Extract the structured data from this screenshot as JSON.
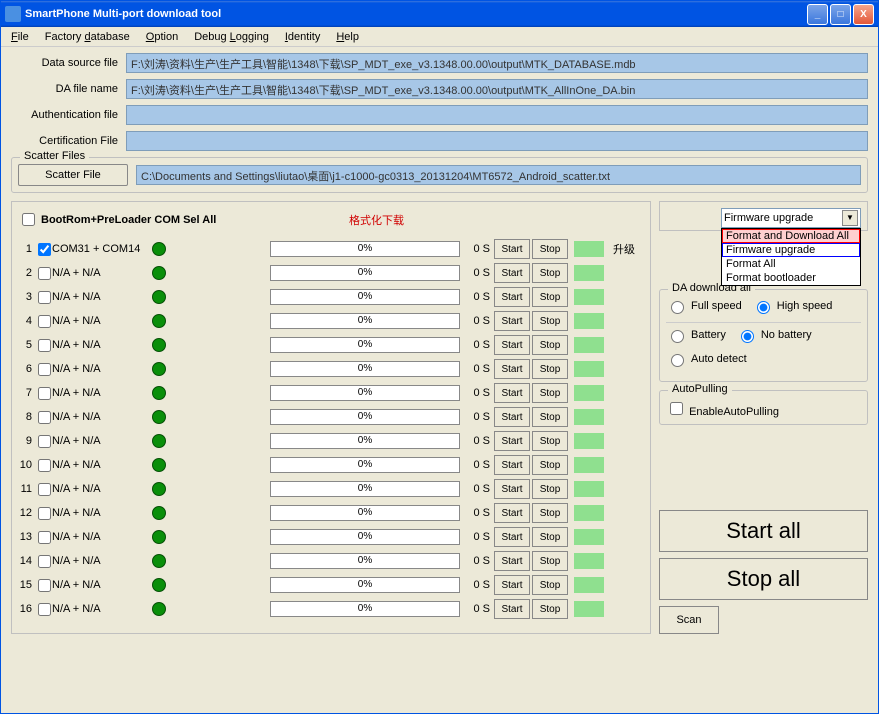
{
  "window": {
    "title": "SmartPhone Multi-port download tool"
  },
  "menu": {
    "file": "File",
    "factory": "Factory database",
    "option": "Option",
    "debug": "Debug Logging",
    "identity": "Identity",
    "help": "Help"
  },
  "files": {
    "datasource_label": "Data source file",
    "datasource_value": "F:\\刘涛\\资料\\生产\\生产工具\\智能\\1348\\下载\\SP_MDT_exe_v3.1348.00.00\\output\\MTK_DATABASE.mdb",
    "da_label": "DA file name",
    "da_value": "F:\\刘涛\\资料\\生产\\生产工具\\智能\\1348\\下载\\SP_MDT_exe_v3.1348.00.00\\output\\MTK_AllInOne_DA.bin",
    "auth_label": "Authentication file",
    "auth_value": "",
    "cert_label": "Certification File",
    "cert_value": ""
  },
  "scatter": {
    "legend": "Scatter Files",
    "button": "Scatter File",
    "path": "C:\\Documents and Settings\\liutao\\桌面\\j1-c1000-gc0313_20131204\\MT6572_Android_scatter.txt"
  },
  "bootrom_label": "BootRom+PreLoader COM Sel All",
  "format_label": "格式化下载",
  "upgrade_label": "升级",
  "dropdown": {
    "selected": "Firmware upgrade",
    "options": [
      "Format and Download All",
      "Firmware upgrade",
      "Format All",
      "Format bootloader"
    ]
  },
  "ports": [
    {
      "num": "1",
      "name": "COM31 + COM14",
      "checked": true,
      "progress": "0%",
      "time": "0 S",
      "start": "Start",
      "stop": "Stop"
    },
    {
      "num": "2",
      "name": "N/A + N/A",
      "checked": false,
      "progress": "0%",
      "time": "0 S",
      "start": "Start",
      "stop": "Stop"
    },
    {
      "num": "3",
      "name": "N/A + N/A",
      "checked": false,
      "progress": "0%",
      "time": "0 S",
      "start": "Start",
      "stop": "Stop"
    },
    {
      "num": "4",
      "name": "N/A + N/A",
      "checked": false,
      "progress": "0%",
      "time": "0 S",
      "start": "Start",
      "stop": "Stop"
    },
    {
      "num": "5",
      "name": "N/A + N/A",
      "checked": false,
      "progress": "0%",
      "time": "0 S",
      "start": "Start",
      "stop": "Stop"
    },
    {
      "num": "6",
      "name": "N/A + N/A",
      "checked": false,
      "progress": "0%",
      "time": "0 S",
      "start": "Start",
      "stop": "Stop"
    },
    {
      "num": "7",
      "name": "N/A + N/A",
      "checked": false,
      "progress": "0%",
      "time": "0 S",
      "start": "Start",
      "stop": "Stop"
    },
    {
      "num": "8",
      "name": "N/A + N/A",
      "checked": false,
      "progress": "0%",
      "time": "0 S",
      "start": "Start",
      "stop": "Stop"
    },
    {
      "num": "9",
      "name": "N/A + N/A",
      "checked": false,
      "progress": "0%",
      "time": "0 S",
      "start": "Start",
      "stop": "Stop"
    },
    {
      "num": "10",
      "name": "N/A + N/A",
      "checked": false,
      "progress": "0%",
      "time": "0 S",
      "start": "Start",
      "stop": "Stop"
    },
    {
      "num": "11",
      "name": "N/A + N/A",
      "checked": false,
      "progress": "0%",
      "time": "0 S",
      "start": "Start",
      "stop": "Stop"
    },
    {
      "num": "12",
      "name": "N/A + N/A",
      "checked": false,
      "progress": "0%",
      "time": "0 S",
      "start": "Start",
      "stop": "Stop"
    },
    {
      "num": "13",
      "name": "N/A + N/A",
      "checked": false,
      "progress": "0%",
      "time": "0 S",
      "start": "Start",
      "stop": "Stop"
    },
    {
      "num": "14",
      "name": "N/A + N/A",
      "checked": false,
      "progress": "0%",
      "time": "0 S",
      "start": "Start",
      "stop": "Stop"
    },
    {
      "num": "15",
      "name": "N/A + N/A",
      "checked": false,
      "progress": "0%",
      "time": "0 S",
      "start": "Start",
      "stop": "Stop"
    },
    {
      "num": "16",
      "name": "N/A + N/A",
      "checked": false,
      "progress": "0%",
      "time": "0 S",
      "start": "Start",
      "stop": "Stop"
    }
  ],
  "da_download": {
    "legend": "DA download all",
    "full_speed": "Full speed",
    "high_speed": "High speed",
    "battery": "Battery",
    "no_battery": "No battery",
    "auto_detect": "Auto detect"
  },
  "autopulling": {
    "legend": "AutoPulling",
    "enable": "EnableAutoPulling"
  },
  "buttons": {
    "start_all": "Start all",
    "stop_all": "Stop all",
    "scan": "Scan"
  }
}
